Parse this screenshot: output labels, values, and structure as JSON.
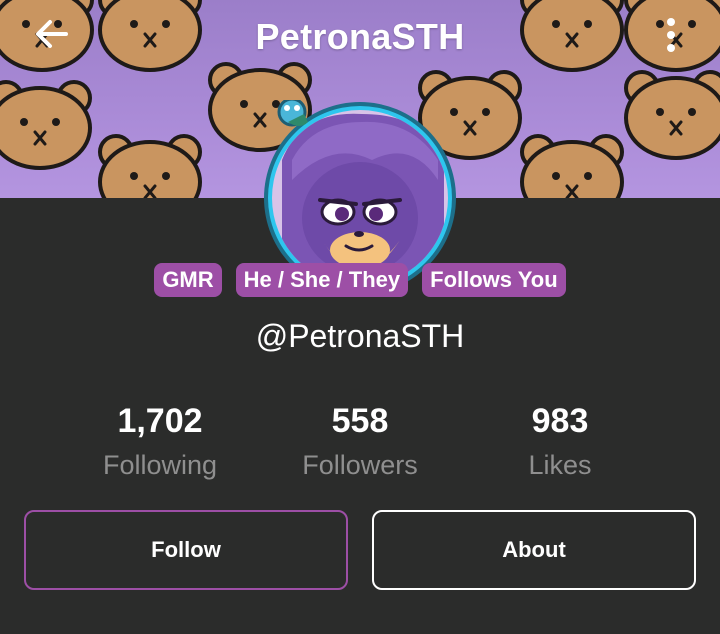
{
  "header": {
    "title": "PetronaSTH",
    "back_icon": "arrow-left-icon",
    "menu_icon": "more-vertical-icon"
  },
  "banner": {
    "pattern": "bear-face-pattern",
    "colors": {
      "bg_top": "#9b7ec9",
      "bg_bottom": "#b495e0",
      "bear": "#c99560"
    }
  },
  "profile": {
    "avatar": "character-avatar",
    "badges": [
      "GMR",
      "He / She / They",
      "Follows You"
    ],
    "handle": "@PetronaSTH"
  },
  "stats": [
    {
      "value": "1,702",
      "label": "Following"
    },
    {
      "value": "558",
      "label": "Followers"
    },
    {
      "value": "983",
      "label": "Likes"
    }
  ],
  "actions": {
    "follow_label": "Follow",
    "about_label": "About"
  },
  "colors": {
    "background": "#2b2c2b",
    "accent": "#9d4fa6",
    "muted_text": "#8f8f8f",
    "avatar_ring": "#2ec6ee"
  }
}
